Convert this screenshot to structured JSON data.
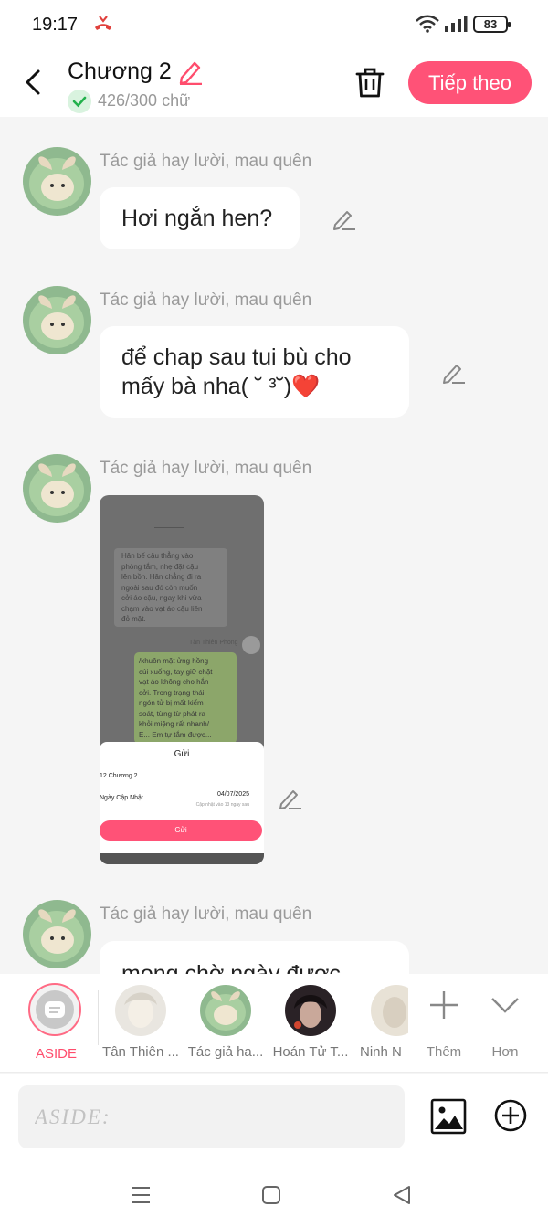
{
  "status_bar": {
    "time": "19:17",
    "battery": "83",
    "missed_call_icon": "missed-call-icon",
    "wifi_icon": "wifi-icon",
    "signal_icon": "signal-icon"
  },
  "header": {
    "title": "Chương 2",
    "word_count": "426/300 chữ",
    "next_label": "Tiếp theo",
    "colors": {
      "accent": "#ff5277",
      "check": "#22b14c"
    }
  },
  "messages": [
    {
      "author": "Tác giả hay lười, mau quên",
      "text": "Hơi ngắn hen?"
    },
    {
      "author": "Tác giả hay lười, mau quên",
      "text_line1": "để chap sau tui bù cho",
      "text_line2": "mấy bà nha( ˘ ³˘)❤️"
    },
    {
      "author": "Tác giả hay lười, mau quên",
      "image": {
        "narration": [
          "Hân bế cậu thẳng vào",
          "phòng tắm, nhẹ đặt cậu",
          "lên bồn. Hân chẳng đi ra",
          "ngoài sau đó còn muốn",
          "cởi áo cậu, ngay khi vừa",
          "chạm vào vạt áo cậu liền",
          "đỏ mặt."
        ],
        "speaker": "Tân Thiên Phong",
        "dialogue": [
          "/khuôn mặt ửng hồng",
          "cúi xuống, tay giữ  chặt",
          "vạt áo không cho hắn",
          "cởi. Trong trạng thái",
          "ngón tử bị mất kiểm",
          "soát, từng từ phát ra",
          "khỏi miệng rất nhanh/",
          "E... Em tự tắm được..."
        ],
        "sheet_title": "Gửi",
        "sheet_chapter": "12  Chương 2",
        "sheet_date_label": "Ngày Cập Nhật",
        "sheet_date": "04/07/2025",
        "sheet_date_sub": "Cập nhật vào 13 ngày sau",
        "sheet_button": "Gửi"
      }
    },
    {
      "author": "Tác giả hay lười, mau quên",
      "text": "mong chờ ngày được"
    }
  ],
  "characters": {
    "aside_label": "ASIDE",
    "items": [
      {
        "label": "Tân Thiên ..."
      },
      {
        "label": "Tác giả ha..."
      },
      {
        "label": "Hoán Tử T..."
      },
      {
        "label": "Ninh N"
      }
    ],
    "add_label": "Thêm",
    "more_label": "Hơn"
  },
  "input": {
    "placeholder": "ASIDE:"
  }
}
